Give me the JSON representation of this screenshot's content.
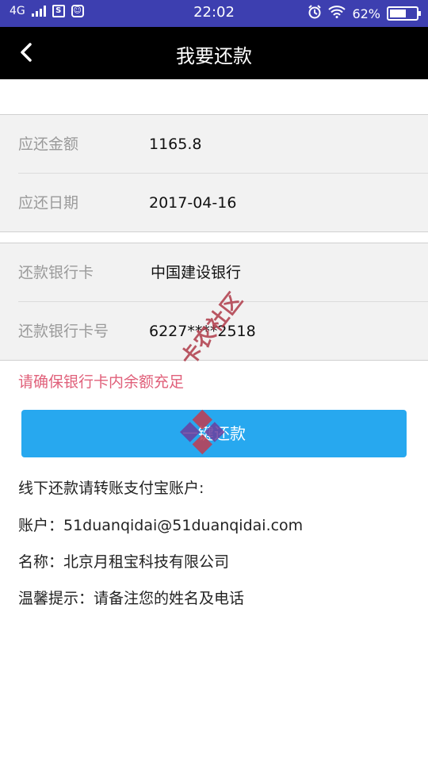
{
  "status_bar": {
    "network": "4G",
    "time": "22:02",
    "battery": "62%",
    "battery_level": 0.62
  },
  "header": {
    "title": "我要还款",
    "back_icon": "chevron-left-icon"
  },
  "payment": {
    "amount_label": "应还金额",
    "amount_value": "1165.8",
    "date_label": "应还日期",
    "date_value": "2017-04-16"
  },
  "bank": {
    "card_label": "还款银行卡",
    "card_value": "中国建设银行",
    "card_no_label": "还款银行卡号",
    "card_no_value": "6227****2518"
  },
  "notice": "请确保银行卡内余额充足",
  "repay_button": "一键还款",
  "offline": {
    "title": "线下还款请转账支付宝账户:",
    "account": "账户：51duanqidai@51duanqidai.com",
    "name": "名称：北京月租宝科技有限公司",
    "tip": "温馨提示：请备注您的姓名及电话"
  },
  "watermark_text": "卡农社区",
  "colors": {
    "status_bar": "#3d3fb0",
    "header": "#000000",
    "accent_button": "#27a8ef",
    "warning_text": "#e0607a",
    "label_gray": "#9a9a9a"
  }
}
